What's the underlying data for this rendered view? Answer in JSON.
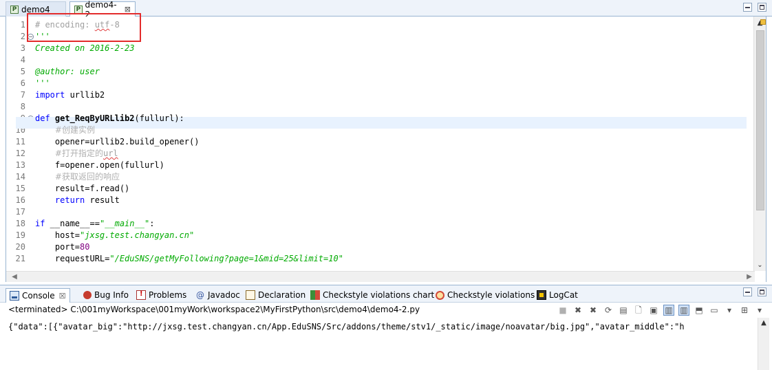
{
  "editor_tabs": [
    {
      "label": "demo4",
      "icon": "python-file-icon",
      "active": false
    },
    {
      "label": "demo4-2",
      "icon": "python-file-icon",
      "active": true,
      "close": "⊠"
    }
  ],
  "editor": {
    "line_numbers": [
      "1",
      "2",
      "3",
      "4",
      "5",
      "6",
      "7",
      "8",
      "9",
      "10",
      "11",
      "12",
      "13",
      "14",
      "15",
      "16",
      "17",
      "18",
      "19",
      "20",
      "21"
    ],
    "lines": [
      [
        {
          "t": "# encoding: ",
          "c": "c-comment"
        },
        {
          "t": "utf",
          "c": "c-comment squiggle"
        },
        {
          "t": "-8",
          "c": "c-comment"
        }
      ],
      [
        {
          "t": "'''",
          "c": "c-doc"
        }
      ],
      [
        {
          "t": "Created on 2016-2-23",
          "c": "c-doc"
        }
      ],
      [],
      [
        {
          "t": "@author: user",
          "c": "c-doc"
        }
      ],
      [
        {
          "t": "'''",
          "c": "c-doc"
        }
      ],
      [
        {
          "t": "import",
          "c": "c-kw"
        },
        {
          "t": " urllib2",
          "c": "c-txt"
        }
      ],
      [],
      [
        {
          "t": "def",
          "c": "c-kw"
        },
        {
          "t": " ",
          "c": "c-txt"
        },
        {
          "t": "get_ReqByURLlib2",
          "c": "c-def"
        },
        {
          "t": "(fullurl):",
          "c": "c-txt"
        }
      ],
      [
        {
          "t": "    ",
          "c": "c-txt"
        },
        {
          "t": "#创建实例",
          "c": "c-cjk"
        }
      ],
      [
        {
          "t": "    opener=urllib2.build_opener()",
          "c": "c-txt"
        }
      ],
      [
        {
          "t": "    ",
          "c": "c-txt"
        },
        {
          "t": "#打开指定的",
          "c": "c-cjk"
        },
        {
          "t": "url",
          "c": "c-comment squiggle"
        }
      ],
      [
        {
          "t": "    f=opener.open(fullurl)",
          "c": "c-txt"
        }
      ],
      [
        {
          "t": "    ",
          "c": "c-txt"
        },
        {
          "t": "#获取返回的响应",
          "c": "c-cjk"
        }
      ],
      [
        {
          "t": "    result=f.read()",
          "c": "c-txt"
        }
      ],
      [
        {
          "t": "    ",
          "c": "c-txt"
        },
        {
          "t": "return",
          "c": "c-kw"
        },
        {
          "t": " result",
          "c": "c-txt"
        }
      ],
      [],
      [
        {
          "t": "if",
          "c": "c-kw"
        },
        {
          "t": " __name__==",
          "c": "c-txt"
        },
        {
          "t": "\"__main__\"",
          "c": "c-str"
        },
        {
          "t": ":",
          "c": "c-txt"
        }
      ],
      [
        {
          "t": "    host=",
          "c": "c-txt"
        },
        {
          "t": "\"jxsg.test.changyan.cn\"",
          "c": "c-str"
        }
      ],
      [
        {
          "t": "    port=",
          "c": "c-txt"
        },
        {
          "t": "80",
          "c": "c-num"
        }
      ],
      [
        {
          "t": "    requestURL=",
          "c": "c-txt"
        },
        {
          "t": "\"/EduSNS/getMyFollowing?page=1&mid=25&limit=10\"",
          "c": "c-str"
        }
      ]
    ]
  },
  "panel_tabs": [
    {
      "label": "Console",
      "icon": "console-icon",
      "active": true,
      "close": "☒"
    },
    {
      "label": "Bug Info",
      "icon": "bug-icon"
    },
    {
      "label": "Problems",
      "icon": "problems-icon"
    },
    {
      "label": "Javadoc",
      "icon": "javadoc-icon",
      "glyph": "@"
    },
    {
      "label": "Declaration",
      "icon": "declaration-icon"
    },
    {
      "label": "Checkstyle violations chart",
      "icon": "checkstyle-chart-icon"
    },
    {
      "label": "Checkstyle violations",
      "icon": "checkstyle-violations-icon"
    },
    {
      "label": "LogCat",
      "icon": "logcat-icon"
    }
  ],
  "console": {
    "status": "<terminated> C:\\001myWorkspace\\001myWork\\workspace2\\MyFirstPython\\src\\demo4\\demo4-2.py",
    "output": "{\"data\":[{\"avatar_big\":\"http://jxsg.test.changyan.cn/App.EduSNS/Src/addons/theme/stv1/_static/image/noavatar/big.jpg\",\"avatar_middle\":\"h"
  },
  "colors": {
    "highlight_box": "#e32b2b",
    "current_line": "#e8f2fe",
    "keyword": "#0000ff",
    "string": "#00aa00"
  }
}
